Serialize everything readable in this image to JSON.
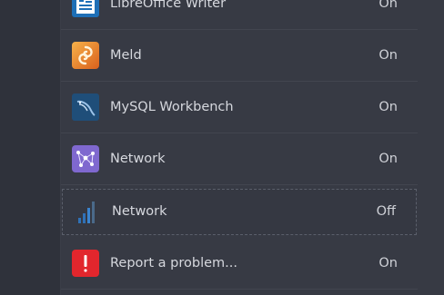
{
  "apps": [
    {
      "name": "LibreOffice Writer",
      "state": "On",
      "icon": "libreoffice-writer-icon"
    },
    {
      "name": "Meld",
      "state": "On",
      "icon": "meld-icon"
    },
    {
      "name": "MySQL Workbench",
      "state": "On",
      "icon": "mysql-workbench-icon"
    },
    {
      "name": "Network",
      "state": "On",
      "icon": "network-icon"
    },
    {
      "name": "Network",
      "state": "Off",
      "icon": "network-signal-icon"
    },
    {
      "name": "Report a problem...",
      "state": "On",
      "icon": "report-problem-icon"
    }
  ],
  "colors": {
    "background": "#2f323b",
    "panel": "#373a44",
    "text": "#d6d8de",
    "report_red": "#e2262d",
    "network_purple": "#7f68cf",
    "signal_blue": "#2f71b7"
  }
}
